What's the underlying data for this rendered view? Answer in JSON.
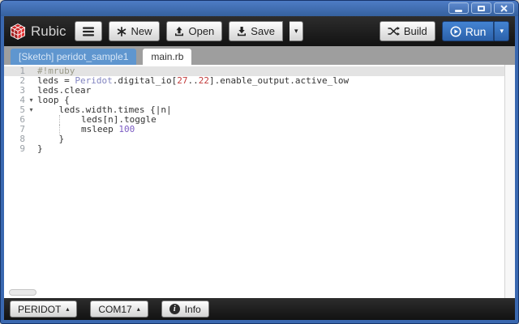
{
  "window": {
    "controls": [
      {
        "name": "minimize"
      },
      {
        "name": "maximize"
      },
      {
        "name": "close"
      }
    ]
  },
  "icons": {
    "caret_down": "▾",
    "caret_up": "▴",
    "logo": "rubic-cube-icon",
    "menu": "hamburger-icon",
    "new": "asterisk-icon",
    "open": "upload-icon",
    "save": "download-icon",
    "build": "shuffle-icon",
    "run": "play-circle-icon",
    "info": "info-circle-icon"
  },
  "toolbar": {
    "app_name": "Rubic",
    "new_label": "New",
    "open_label": "Open",
    "save_label": "Save",
    "build_label": "Build",
    "run_label": "Run"
  },
  "tabs": [
    {
      "label": "[Sketch] peridot_sample1",
      "active": false
    },
    {
      "label": "main.rb",
      "active": true
    }
  ],
  "editor": {
    "fold_glyph": "▾",
    "info_glyph": "i",
    "lines": [
      {
        "number": 1,
        "active": true,
        "fold": false,
        "segments": [
          {
            "t": "comment",
            "s": "#!mruby"
          }
        ]
      },
      {
        "number": 2,
        "active": false,
        "fold": false,
        "segments": [
          {
            "t": "plain",
            "s": "leds = "
          },
          {
            "t": "const",
            "s": "Peridot"
          },
          {
            "t": "plain",
            "s": ".digital_io["
          },
          {
            "t": "num",
            "s": "27"
          },
          {
            "t": "plain",
            "s": ".."
          },
          {
            "t": "num",
            "s": "22"
          },
          {
            "t": "plain",
            "s": "].enable_output.active_low"
          }
        ]
      },
      {
        "number": 3,
        "active": false,
        "fold": false,
        "segments": [
          {
            "t": "plain",
            "s": "leds.clear"
          }
        ]
      },
      {
        "number": 4,
        "active": false,
        "fold": true,
        "segments": [
          {
            "t": "plain",
            "s": "loop {"
          }
        ]
      },
      {
        "number": 5,
        "active": false,
        "fold": true,
        "segments": [
          {
            "t": "plain",
            "s": "    leds.width.times {|n|"
          }
        ]
      },
      {
        "number": 6,
        "active": false,
        "fold": false,
        "segments": [
          {
            "t": "plain",
            "s": "    "
          },
          {
            "t": "guide"
          },
          {
            "t": "plain",
            "s": "    leds[n].toggle"
          }
        ]
      },
      {
        "number": 7,
        "active": false,
        "fold": false,
        "segments": [
          {
            "t": "plain",
            "s": "    "
          },
          {
            "t": "guide"
          },
          {
            "t": "plain",
            "s": "    msleep "
          },
          {
            "t": "num2",
            "s": "100"
          }
        ]
      },
      {
        "number": 8,
        "active": false,
        "fold": false,
        "segments": [
          {
            "t": "plain",
            "s": "    }"
          }
        ]
      },
      {
        "number": 9,
        "active": false,
        "fold": false,
        "segments": [
          {
            "t": "plain",
            "s": "}"
          }
        ]
      }
    ]
  },
  "statusbar": {
    "board_label": "PERIDOT",
    "port_label": "COM17",
    "info_label": "Info"
  },
  "colors": {
    "frame-blue": "#3a68b0",
    "titlebar-top": "#4e7cc5",
    "titlebar-bottom": "#35619e",
    "bar-dark-top": "#2d2d2d",
    "bar-dark-bottom": "#121212",
    "tabbar-gray": "#9e9e9e",
    "tab-sketch-bg": "#5f96cf",
    "tab-sketch-text": "#d7e6f6",
    "run-blue-top": "#4484d3",
    "run-blue-bottom": "#2b61aa",
    "run-border": "#1b3f76",
    "code-comment": "#999988",
    "code-plain": "#333333",
    "code-const": "#8285c1",
    "code-number": "#c23b3b",
    "code-number-alt": "#7c5cc4",
    "active-line": "#e3e3e3",
    "gutter-text": "#9aa0a6"
  }
}
